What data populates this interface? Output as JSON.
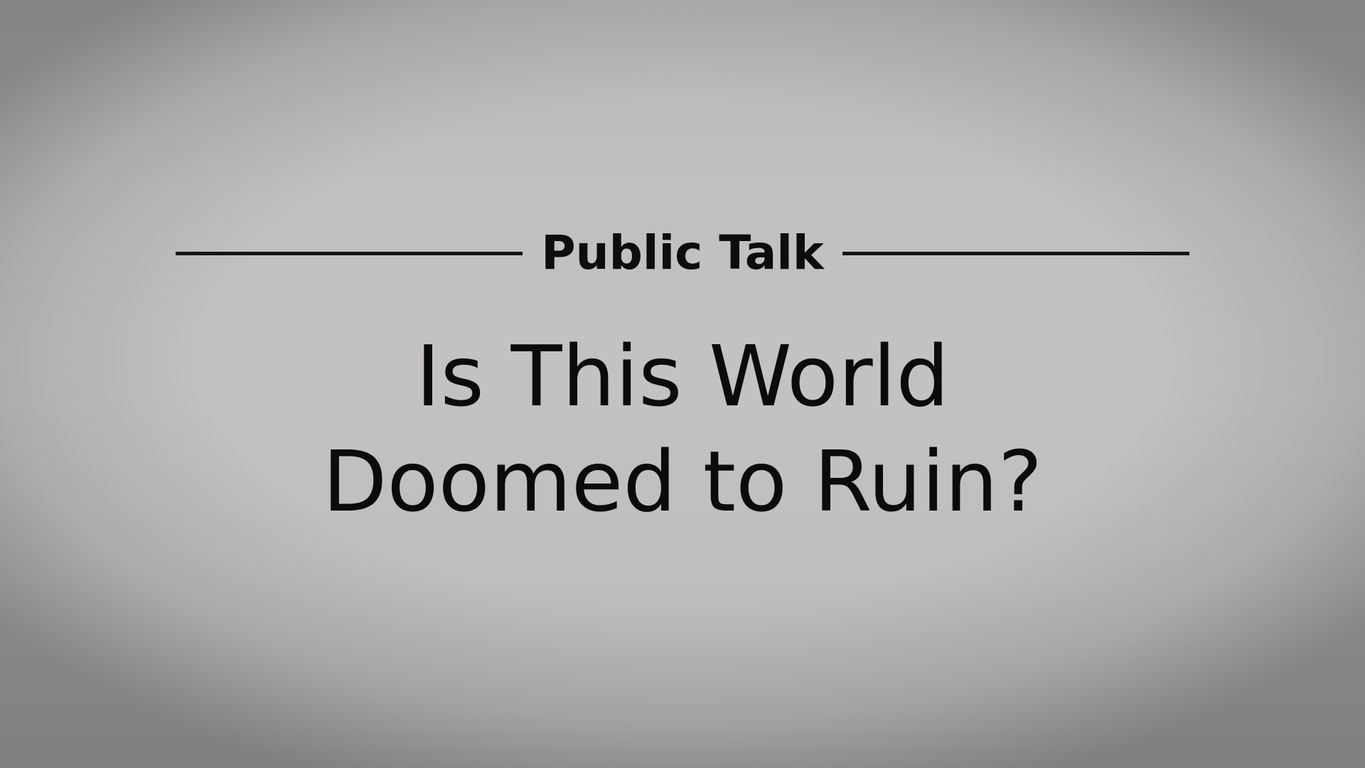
{
  "slide": {
    "subtitle": "Public Talk",
    "title_lines": [
      "Is This World",
      "Doomed to Ruin?"
    ]
  },
  "colors": {
    "background": "#c3c1c0",
    "text": "#0b0b0b",
    "rule": "#141414"
  }
}
